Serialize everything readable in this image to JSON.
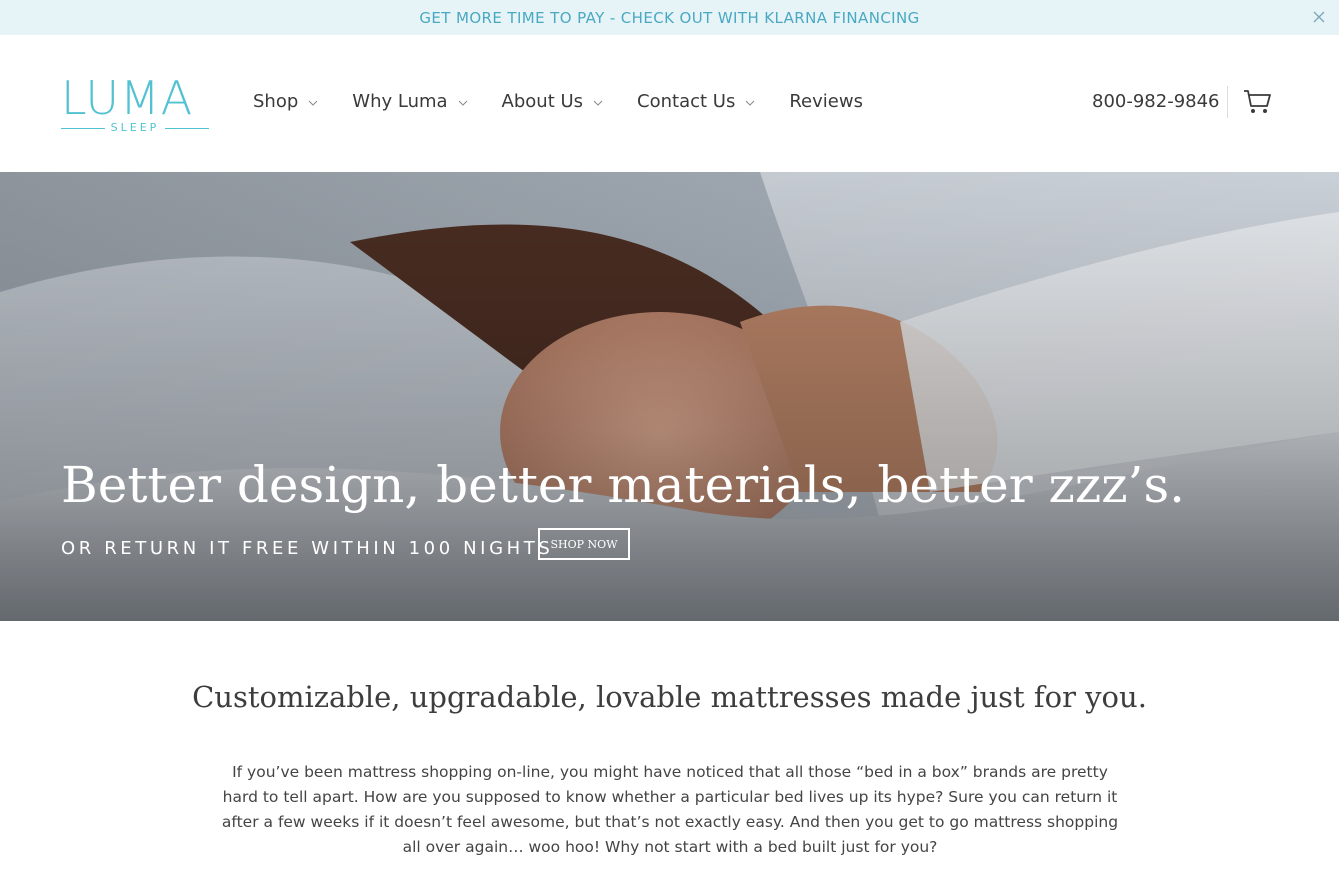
{
  "announcement": {
    "text": "GET MORE TIME TO PAY - CHECK OUT WITH KLARNA FINANCING",
    "close_icon": "close-icon"
  },
  "header": {
    "logo": {
      "main": "LUMA",
      "sub": "SLEEP"
    },
    "nav": [
      {
        "label": "Shop",
        "has_dropdown": true
      },
      {
        "label": "Why Luma",
        "has_dropdown": true
      },
      {
        "label": "About Us",
        "has_dropdown": true
      },
      {
        "label": "Contact Us",
        "has_dropdown": true
      },
      {
        "label": "Reviews",
        "has_dropdown": false
      }
    ],
    "phone": "800-982-9846",
    "cart_icon": "cart-icon"
  },
  "hero": {
    "title": "Better design, better materials, better zzz’s.",
    "subtitle": "OR RETURN IT FREE WITHIN 100 NIGHTS",
    "button_label": "SHOP NOW"
  },
  "main": {
    "tagline": "Customizable, upgradable, lovable mattresses made just for you.",
    "intro": "If you’ve been mattress shopping on-line, you might have noticed that all those “bed in a box” brands are pretty hard to tell apart. How are you supposed to know whether a particular bed lives up its hype? Sure you can return it after a few weeks if it doesn’t feel awesome, but that’s not exactly easy. And then you get to go mattress shopping all over again… woo hoo! Why not start with a bed built just for you?"
  },
  "colors": {
    "brand": "#52c1d1",
    "announcement_bg": "#e6f3f7",
    "announcement_text": "#4aa9c2"
  }
}
